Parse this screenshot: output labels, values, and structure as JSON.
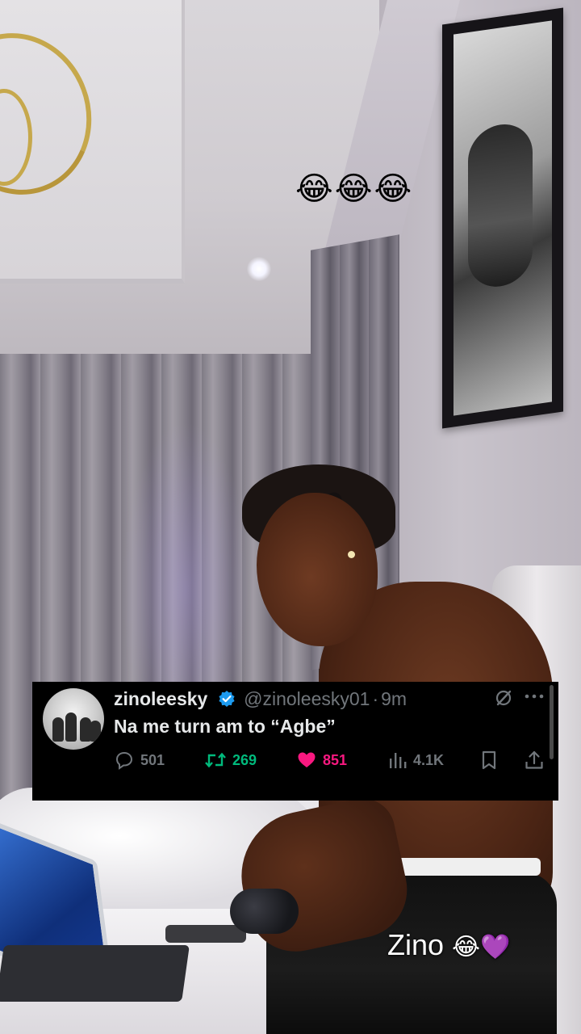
{
  "overlay_emoji": "😂😂😂",
  "tweet": {
    "display_name": "zinoleesky",
    "handle": "@zinoleesky01",
    "separator": "·",
    "time": "9m",
    "text": "Na me turn am to “Agbe”",
    "replies": "501",
    "retweets": "269",
    "likes": "851",
    "views": "4.1K",
    "colors": {
      "background": "#000000",
      "text": "#e7e9ea",
      "muted": "#71767b",
      "verified": "#1d9bf0",
      "retweet": "#00ba7c",
      "like": "#f91880"
    },
    "icons": [
      "reply-icon",
      "retweet-icon",
      "like-icon",
      "views-icon",
      "bookmark-icon",
      "share-icon",
      "grok-icon",
      "more-icon",
      "verified-badge-icon"
    ]
  },
  "caption": {
    "text": "Zino",
    "emoji": "😂💜"
  }
}
